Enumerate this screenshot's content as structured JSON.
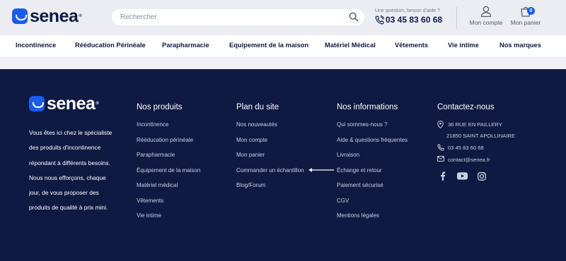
{
  "header": {
    "logo_text": "senea",
    "search_placeholder": "Rechercher",
    "contact_question": "Une question, besoin d'aide ?",
    "phone": "03 45 83 60 68",
    "account_label": "Mon compte",
    "cart_label": "Mon panier",
    "cart_count": "0"
  },
  "nav": {
    "items": [
      "Incontinence",
      "Rééducation Périnéale",
      "Parapharmacie",
      "Equipement de la maison",
      "Matériel Médical",
      "Vêtements",
      "Vie intime",
      "Nos marques"
    ]
  },
  "footer": {
    "logo_text": "senea",
    "description": "Vous êtes ici chez le spécialiste des produits d'incontinence répondant à différents besoins. Nous nous efforçons, chaque jour, de vous proposer des produits de qualité à prix mini.",
    "columns": [
      {
        "title": "Nos produits",
        "links": [
          "Incontinence",
          "Rééducation périnéale",
          "Parapharmacie",
          "Équipement de la maison",
          "Matériel médical",
          "Vêtements",
          "Vie intime"
        ]
      },
      {
        "title": "Plan du site",
        "links": [
          "Nos nouveautés",
          "Mon compte",
          "Mon panier",
          "Commander un échantillon",
          "Blog/Forum"
        ]
      },
      {
        "title": "Nos informations",
        "links": [
          "Qui sommes-nous ?",
          "Aide & questions fréquentes",
          "Livraison",
          "Échange et retour",
          "Paiement sécurisé",
          "CGV",
          "Mentions légales"
        ]
      }
    ],
    "contact": {
      "title": "Contactez-nous",
      "address_line1": "36 RUE EN PAILLERY",
      "address_line2": "21850 SAINT APOLLINAIRE",
      "phone": "03 45 83 60 68",
      "email": "contact@senea.fr"
    },
    "social": [
      "facebook-icon",
      "youtube-icon",
      "instagram-icon"
    ]
  },
  "colors": {
    "brand_blue": "#1a5ce6",
    "footer_bg": "#0f1a43",
    "nav_text": "#0d1a44"
  }
}
